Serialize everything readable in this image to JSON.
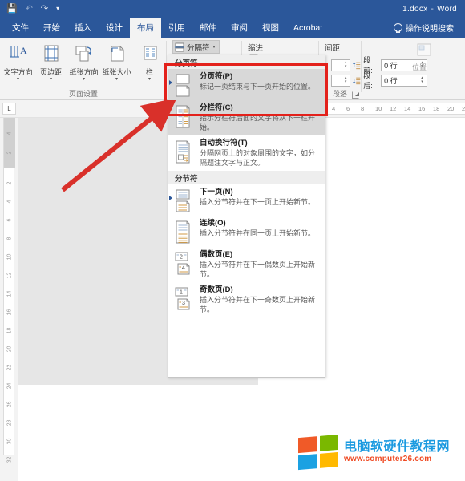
{
  "titlebar": {
    "doc_name": "1.docx",
    "separator": "-",
    "app_name": "Word",
    "qat": {
      "save": "save-icon",
      "undo": "undo-icon",
      "redo": "redo-icon",
      "customize": "customize-qat-icon"
    }
  },
  "tabs": [
    {
      "label": "文件",
      "active": false
    },
    {
      "label": "开始",
      "active": false
    },
    {
      "label": "插入",
      "active": false
    },
    {
      "label": "设计",
      "active": false
    },
    {
      "label": "布局",
      "active": true
    },
    {
      "label": "引用",
      "active": false
    },
    {
      "label": "邮件",
      "active": false
    },
    {
      "label": "审阅",
      "active": false
    },
    {
      "label": "视图",
      "active": false
    },
    {
      "label": "Acrobat",
      "active": false
    }
  ],
  "tell_me": "操作说明搜索",
  "ribbon": {
    "page_setup": {
      "group_label": "页面设置",
      "buttons": [
        {
          "label": "文字方向",
          "icon": "text-direction-icon"
        },
        {
          "label": "页边距",
          "icon": "margins-icon"
        },
        {
          "label": "纸张方向",
          "icon": "orientation-icon"
        },
        {
          "label": "纸张大小",
          "icon": "paper-size-icon"
        },
        {
          "label": "栏",
          "icon": "columns-icon"
        }
      ]
    },
    "paragraph": {
      "group_label": "段落",
      "breaks_button": "分隔符",
      "indent_label": "缩进",
      "spacing_label": "间距",
      "spacing_before_label": "段前:",
      "spacing_before_value": "0 行",
      "spacing_after_label": "段后:",
      "spacing_after_value": "0 行"
    },
    "arrange": {
      "group_label": "位置"
    }
  },
  "ruler": {
    "corner_marker": "L",
    "horizontal_ticks": [
      "4",
      "6",
      "8",
      "10",
      "12",
      "14",
      "16",
      "18",
      "20",
      "2"
    ],
    "vertical_grey_ticks": [
      "4",
      "2"
    ],
    "vertical_ticks": [
      "2",
      "4",
      "6",
      "8",
      "10",
      "12",
      "14",
      "16",
      "18",
      "20",
      "22",
      "24",
      "26",
      "28",
      "30",
      "32"
    ]
  },
  "menu": {
    "sections": [
      {
        "header": "分页符",
        "items": [
          {
            "title": "分页符(P)",
            "desc": "标记一页结束与下一页开始的位置。",
            "icon": "page-break-icon",
            "selected": true,
            "marker": true
          },
          {
            "title": "分栏符(C)",
            "desc": "指示分栏符后面的文字将从下一栏开始。",
            "icon": "column-break-icon",
            "selected": true,
            "marker": false
          },
          {
            "title": "自动换行符(T)",
            "desc": "分隔网页上的对象周围的文字，如分隔题注文字与正文。",
            "icon": "text-wrapping-icon",
            "selected": false,
            "marker": false
          }
        ]
      },
      {
        "header": "分节符",
        "items": [
          {
            "title": "下一页(N)",
            "desc": "插入分节符并在下一页上开始新节。",
            "icon": "next-page-section-icon",
            "selected": false,
            "marker": true
          },
          {
            "title": "连续(O)",
            "desc": "插入分节符并在同一页上开始新节。",
            "icon": "continuous-section-icon",
            "selected": false,
            "marker": false
          },
          {
            "title": "偶数页(E)",
            "desc": "插入分节符并在下一偶数页上开始新节。",
            "icon": "even-page-section-icon",
            "selected": false,
            "marker": false
          },
          {
            "title": "奇数页(D)",
            "desc": "插入分节符并在下一奇数页上开始新节。",
            "icon": "odd-page-section-icon",
            "selected": false,
            "marker": false
          }
        ]
      }
    ]
  },
  "annotations": {
    "highlight_color": "#e3211b",
    "arrow": "red-arrow-pointing-to-page-break-item"
  },
  "watermark": {
    "title": "电脑软硬件教程网",
    "url": "www.computer26.com",
    "logo_colors": [
      "#f05a28",
      "#7ab800",
      "#1ba1e2",
      "#ffb900"
    ],
    "title_color": "#1b9ae0",
    "url_color": "#ef4a23"
  },
  "colors": {
    "word_blue": "#2b579a",
    "ribbon_bg": "#f3f3f3",
    "page_bg": "#e6e6e6"
  }
}
